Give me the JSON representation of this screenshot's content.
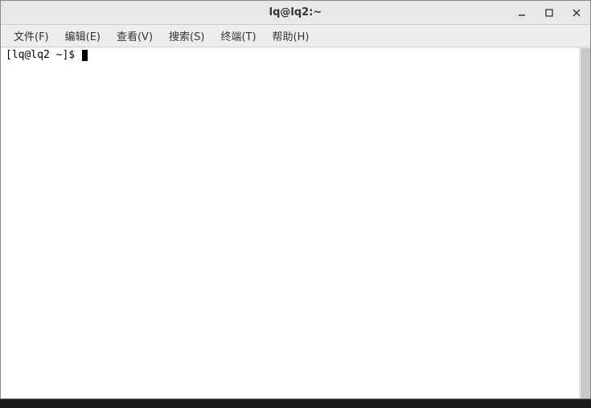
{
  "titlebar": {
    "title": "lq@lq2:~"
  },
  "menubar": {
    "items": [
      {
        "label": "文件(F)"
      },
      {
        "label": "编辑(E)"
      },
      {
        "label": "查看(V)"
      },
      {
        "label": "搜索(S)"
      },
      {
        "label": "终端(T)"
      },
      {
        "label": "帮助(H)"
      }
    ]
  },
  "terminal": {
    "prompt": "[lq@lq2 ~]$ "
  }
}
